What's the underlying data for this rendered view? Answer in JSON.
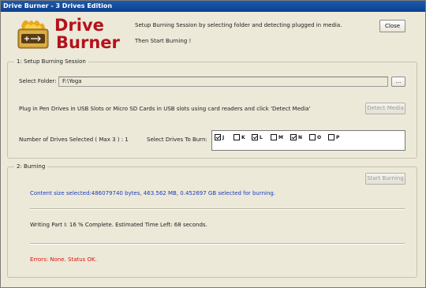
{
  "window": {
    "title": "Drive Burner - 3 Drives Edition"
  },
  "header": {
    "logo_line1": "Drive",
    "logo_line2": "Burner",
    "instruction_line1": "Setup Burning Session by selecting folder and detecting plugged in media.",
    "instruction_line2": "Then Start Burning !",
    "close_label": "Close"
  },
  "setup": {
    "group_title": "1: Setup Burning Session",
    "folder_label": "Select Folder:",
    "folder_value": "F:\\Yoga",
    "browse_label": "...",
    "plug_instruction": "Plug in Pen Drives in USB Slots or Micro SD Cards in USB slots using card readers and click 'Detect Media'",
    "detect_label": "Detect Media",
    "drives_count_label": "Number of Drives Selected ( Max 3 ) : 1",
    "select_drives_label": "Select Drives To Burn:",
    "drives": [
      {
        "letter": "J",
        "checked": true
      },
      {
        "letter": "K",
        "checked": false
      },
      {
        "letter": "L",
        "checked": true
      },
      {
        "letter": "M",
        "checked": false
      },
      {
        "letter": "N",
        "checked": true
      },
      {
        "letter": "O",
        "checked": false
      },
      {
        "letter": "P",
        "checked": false
      }
    ]
  },
  "burning": {
    "group_title": "2: Burning",
    "start_label": "Start Burning",
    "content_size": "Content size selected:486079740 bytes, 463.562 MB, 0.452697 GB selected for burning.",
    "progress": "Writing Part I: 16 % Complete.   Estimated Time Left: 68 seconds.",
    "status": "Errors: None. Status OK."
  },
  "colors": {
    "titlebar": "#0a3f91",
    "logo": "#b5121b",
    "info_text": "#1a3cc2",
    "status_text": "#e01010",
    "window_bg": "#ECE9D8"
  }
}
